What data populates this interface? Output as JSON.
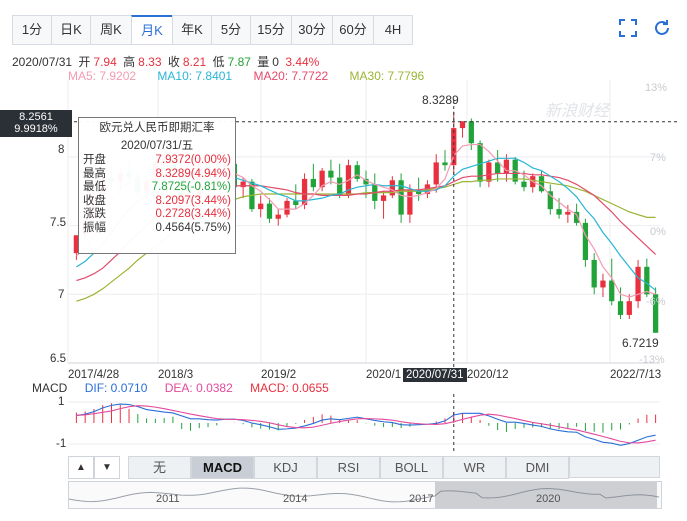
{
  "tabs": [
    {
      "label": "1分",
      "active": false
    },
    {
      "label": "日K",
      "active": false
    },
    {
      "label": "周K",
      "active": false
    },
    {
      "label": "月K",
      "active": true
    },
    {
      "label": "年K",
      "active": false
    },
    {
      "label": "5分",
      "active": false
    },
    {
      "label": "15分",
      "active": false
    },
    {
      "label": "30分",
      "active": false
    },
    {
      "label": "60分",
      "active": false
    },
    {
      "label": "4H",
      "active": false
    }
  ],
  "tools": {
    "fullscreen_icon": "fullscreen-icon",
    "refresh_icon": "refresh-icon"
  },
  "info": {
    "date": "2020/07/31",
    "open_label": "开",
    "open": "7.94",
    "high_label": "高",
    "high": "8.33",
    "close_label": "收",
    "close": "8.21",
    "low_label": "低",
    "low": "7.87",
    "vol_label": "量",
    "vol": "0",
    "change": "3.44%"
  },
  "ma": {
    "ma5": "MA5: 7.9202",
    "ma10": "MA10: 7.8401",
    "ma20": "MA20: 7.7722",
    "ma30": "MA30: 7.7796"
  },
  "colors": {
    "up": "#e8303e",
    "down": "#21a33a",
    "ma5": "#f39bb2",
    "ma10": "#29b5d6",
    "ma20": "#e34a6b",
    "ma30": "#9ab534",
    "accent": "#2a6fd6"
  },
  "crosshair": {
    "price": "8.2561",
    "pct": "9.9918%",
    "date": "2020/07/31",
    "high_label": "8.3289",
    "last_label": "6.7219"
  },
  "pct_labels": [
    "13%",
    "7%",
    "0%",
    "-6%",
    "-13%"
  ],
  "watermark": "新浪财经",
  "tooltip": {
    "title": "欧元兑人民币即期汇率",
    "date": "2020/07/31/五",
    "rows": [
      {
        "label": "开盘",
        "value": "7.9372(0.00%)"
      },
      {
        "label": "最高",
        "value": "8.3289(4.94%)"
      },
      {
        "label": "最低",
        "value": "7.8725(-0.81%)"
      },
      {
        "label": "收盘",
        "value": "8.2097(3.44%)"
      },
      {
        "label": "涨跌",
        "value": "0.2728(3.44%)"
      },
      {
        "label": "振幅",
        "value": "0.4564(5.75%)"
      }
    ]
  },
  "chart_data": {
    "type": "candlestick",
    "title": "欧元兑人民币即期汇率 月K",
    "ylim": [
      6.5,
      8.55
    ],
    "y_ticks": [
      "8",
      "7.5",
      "7",
      "6.5"
    ],
    "x_ticks": [
      "2017/4/28",
      "2018/3",
      "2019/2",
      "2020/1",
      "2020/12",
      "2022/7/13"
    ],
    "candles": [
      {
        "o": 7.3,
        "h": 7.42,
        "l": 7.25,
        "c": 7.43
      },
      {
        "o": 7.43,
        "h": 7.56,
        "l": 7.4,
        "c": 7.55
      },
      {
        "o": 7.55,
        "h": 7.75,
        "l": 7.53,
        "c": 7.72
      },
      {
        "o": 7.72,
        "h": 7.9,
        "l": 7.7,
        "c": 7.85
      },
      {
        "o": 7.85,
        "h": 7.93,
        "l": 7.78,
        "c": 7.82
      },
      {
        "o": 7.82,
        "h": 7.92,
        "l": 7.76,
        "c": 7.88
      },
      {
        "o": 7.88,
        "h": 7.99,
        "l": 7.8,
        "c": 7.85
      },
      {
        "o": 7.85,
        "h": 7.9,
        "l": 7.72,
        "c": 7.75
      },
      {
        "o": 7.75,
        "h": 7.85,
        "l": 7.7,
        "c": 7.83
      },
      {
        "o": 7.83,
        "h": 7.98,
        "l": 7.8,
        "c": 7.95
      },
      {
        "o": 7.95,
        "h": 8.02,
        "l": 7.9,
        "c": 7.98
      },
      {
        "o": 7.98,
        "h": 8.04,
        "l": 7.85,
        "c": 7.9
      },
      {
        "o": 7.9,
        "h": 7.95,
        "l": 7.65,
        "c": 7.72
      },
      {
        "o": 7.72,
        "h": 7.78,
        "l": 7.62,
        "c": 7.7
      },
      {
        "o": 7.7,
        "h": 8.05,
        "l": 7.68,
        "c": 7.99
      },
      {
        "o": 7.99,
        "h": 8.02,
        "l": 7.78,
        "c": 7.8
      },
      {
        "o": 7.8,
        "h": 7.95,
        "l": 7.78,
        "c": 7.9
      },
      {
        "o": 7.9,
        "h": 8.02,
        "l": 7.85,
        "c": 7.95
      },
      {
        "o": 7.95,
        "h": 7.97,
        "l": 7.72,
        "c": 7.78
      },
      {
        "o": 7.78,
        "h": 7.85,
        "l": 7.7,
        "c": 7.82
      },
      {
        "o": 7.82,
        "h": 7.84,
        "l": 7.6,
        "c": 7.62
      },
      {
        "o": 7.62,
        "h": 7.72,
        "l": 7.56,
        "c": 7.66
      },
      {
        "o": 7.66,
        "h": 7.7,
        "l": 7.52,
        "c": 7.55
      },
      {
        "o": 7.55,
        "h": 7.62,
        "l": 7.5,
        "c": 7.58
      },
      {
        "o": 7.58,
        "h": 7.7,
        "l": 7.56,
        "c": 7.68
      },
      {
        "o": 7.68,
        "h": 7.8,
        "l": 7.62,
        "c": 7.65
      },
      {
        "o": 7.65,
        "h": 7.88,
        "l": 7.62,
        "c": 7.84
      },
      {
        "o": 7.84,
        "h": 7.95,
        "l": 7.75,
        "c": 7.78
      },
      {
        "o": 7.78,
        "h": 7.92,
        "l": 7.75,
        "c": 7.9
      },
      {
        "o": 7.9,
        "h": 7.98,
        "l": 7.8,
        "c": 7.85
      },
      {
        "o": 7.85,
        "h": 7.95,
        "l": 7.7,
        "c": 7.72
      },
      {
        "o": 7.72,
        "h": 7.98,
        "l": 7.7,
        "c": 7.94
      },
      {
        "o": 7.94,
        "h": 7.97,
        "l": 7.82,
        "c": 7.84
      },
      {
        "o": 7.84,
        "h": 7.9,
        "l": 7.7,
        "c": 7.8
      },
      {
        "o": 7.8,
        "h": 7.88,
        "l": 7.62,
        "c": 7.68
      },
      {
        "o": 7.68,
        "h": 7.75,
        "l": 7.55,
        "c": 7.72
      },
      {
        "o": 7.72,
        "h": 7.86,
        "l": 7.7,
        "c": 7.83
      },
      {
        "o": 7.83,
        "h": 7.88,
        "l": 7.52,
        "c": 7.58
      },
      {
        "o": 7.58,
        "h": 7.8,
        "l": 7.52,
        "c": 7.76
      },
      {
        "o": 7.76,
        "h": 7.85,
        "l": 7.68,
        "c": 7.73
      },
      {
        "o": 7.73,
        "h": 7.83,
        "l": 7.7,
        "c": 7.8
      },
      {
        "o": 7.8,
        "h": 8.02,
        "l": 7.74,
        "c": 7.96
      },
      {
        "o": 7.96,
        "h": 8.05,
        "l": 7.9,
        "c": 7.94
      },
      {
        "o": 7.94,
        "h": 8.33,
        "l": 7.87,
        "c": 8.21
      },
      {
        "o": 8.21,
        "h": 8.25,
        "l": 8.14,
        "c": 8.26
      },
      {
        "o": 8.26,
        "h": 8.28,
        "l": 8.05,
        "c": 8.1
      },
      {
        "o": 8.1,
        "h": 8.12,
        "l": 7.78,
        "c": 7.82
      },
      {
        "o": 7.82,
        "h": 7.98,
        "l": 7.78,
        "c": 7.96
      },
      {
        "o": 7.96,
        "h": 8.05,
        "l": 7.82,
        "c": 7.88
      },
      {
        "o": 7.88,
        "h": 8.02,
        "l": 7.82,
        "c": 7.98
      },
      {
        "o": 7.98,
        "h": 8.0,
        "l": 7.8,
        "c": 7.82
      },
      {
        "o": 7.82,
        "h": 7.9,
        "l": 7.75,
        "c": 7.78
      },
      {
        "o": 7.78,
        "h": 7.88,
        "l": 7.74,
        "c": 7.86
      },
      {
        "o": 7.86,
        "h": 7.9,
        "l": 7.74,
        "c": 7.75
      },
      {
        "o": 7.75,
        "h": 7.8,
        "l": 7.58,
        "c": 7.62
      },
      {
        "o": 7.62,
        "h": 7.7,
        "l": 7.55,
        "c": 7.58
      },
      {
        "o": 7.58,
        "h": 7.65,
        "l": 7.52,
        "c": 7.6
      },
      {
        "o": 7.6,
        "h": 7.66,
        "l": 7.5,
        "c": 7.52
      },
      {
        "o": 7.52,
        "h": 7.55,
        "l": 7.2,
        "c": 7.25
      },
      {
        "o": 7.25,
        "h": 7.3,
        "l": 7.0,
        "c": 7.05
      },
      {
        "o": 7.05,
        "h": 7.15,
        "l": 6.98,
        "c": 7.1
      },
      {
        "o": 7.1,
        "h": 7.26,
        "l": 6.92,
        "c": 6.95
      },
      {
        "o": 6.95,
        "h": 7.05,
        "l": 6.82,
        "c": 6.85
      },
      {
        "o": 6.85,
        "h": 7.0,
        "l": 6.82,
        "c": 6.95
      },
      {
        "o": 6.95,
        "h": 7.25,
        "l": 6.9,
        "c": 7.2
      },
      {
        "o": 7.2,
        "h": 7.26,
        "l": 6.98,
        "c": 7.0
      },
      {
        "o": 7.0,
        "h": 7.05,
        "l": 6.72,
        "c": 6.72
      }
    ],
    "ma5": [
      7.28,
      7.33,
      7.42,
      7.55,
      7.67,
      7.76,
      7.82,
      7.83,
      7.82,
      7.85,
      7.87,
      7.9,
      7.86,
      7.81,
      7.83,
      7.83,
      7.84,
      7.87,
      7.88,
      7.85,
      7.79,
      7.75,
      7.69,
      7.62,
      7.62,
      7.62,
      7.66,
      7.72,
      7.79,
      7.82,
      7.8,
      7.83,
      7.87,
      7.83,
      7.8,
      7.78,
      7.76,
      7.72,
      7.71,
      7.72,
      7.74,
      7.77,
      7.84,
      8.01,
      8.08,
      8.09,
      8.09,
      8.04,
      7.97,
      7.9,
      7.9,
      7.87,
      7.82,
      7.79,
      7.72,
      7.67,
      7.62,
      7.58,
      7.43,
      7.33,
      7.2,
      7.12,
      7.0,
      6.98,
      7.0,
      7.02,
      7.0
    ],
    "ma10": [
      7.2,
      7.24,
      7.3,
      7.37,
      7.45,
      7.54,
      7.62,
      7.68,
      7.72,
      7.77,
      7.81,
      7.83,
      7.84,
      7.83,
      7.83,
      7.85,
      7.85,
      7.86,
      7.85,
      7.83,
      7.81,
      7.79,
      7.76,
      7.73,
      7.71,
      7.68,
      7.68,
      7.69,
      7.7,
      7.72,
      7.73,
      7.76,
      7.78,
      7.79,
      7.8,
      7.79,
      7.79,
      7.79,
      7.77,
      7.75,
      7.75,
      7.76,
      7.79,
      7.86,
      7.91,
      7.93,
      7.95,
      7.97,
      7.99,
      7.99,
      7.99,
      7.96,
      7.92,
      7.9,
      7.86,
      7.82,
      7.77,
      7.71,
      7.62,
      7.55,
      7.45,
      7.37,
      7.28,
      7.2,
      7.12,
      7.08,
      7.03
    ],
    "ma20": [
      7.1,
      7.12,
      7.15,
      7.19,
      7.25,
      7.31,
      7.38,
      7.44,
      7.5,
      7.56,
      7.61,
      7.66,
      7.69,
      7.71,
      7.73,
      7.75,
      7.77,
      7.78,
      7.79,
      7.79,
      7.79,
      7.79,
      7.78,
      7.77,
      7.76,
      7.74,
      7.73,
      7.73,
      7.72,
      7.72,
      7.72,
      7.72,
      7.73,
      7.73,
      7.74,
      7.75,
      7.75,
      7.76,
      7.76,
      7.76,
      7.77,
      7.78,
      7.79,
      7.82,
      7.85,
      7.86,
      7.86,
      7.87,
      7.88,
      7.88,
      7.88,
      7.88,
      7.87,
      7.87,
      7.86,
      7.85,
      7.83,
      7.8,
      7.76,
      7.72,
      7.66,
      7.6,
      7.53,
      7.47,
      7.41,
      7.35,
      7.29
    ],
    "ma30": [
      6.95,
      6.97,
      7.0,
      7.04,
      7.09,
      7.14,
      7.19,
      7.25,
      7.3,
      7.35,
      7.4,
      7.45,
      7.5,
      7.54,
      7.58,
      7.61,
      7.64,
      7.67,
      7.69,
      7.71,
      7.72,
      7.73,
      7.73,
      7.73,
      7.73,
      7.73,
      7.73,
      7.73,
      7.73,
      7.73,
      7.73,
      7.73,
      7.73,
      7.74,
      7.74,
      7.74,
      7.74,
      7.75,
      7.75,
      7.75,
      7.76,
      7.77,
      7.78,
      7.8,
      7.82,
      7.82,
      7.83,
      7.83,
      7.84,
      7.84,
      7.84,
      7.84,
      7.83,
      7.82,
      7.81,
      7.8,
      7.79,
      7.77,
      7.75,
      7.72,
      7.69,
      7.66,
      7.63,
      7.6,
      7.58,
      7.56,
      7.56
    ]
  },
  "macd": {
    "label": "MACD",
    "dif": "DIF: 0.0710",
    "dea": "DEA: 0.0382",
    "macd": "MACD: 0.0655",
    "y_ticks": [
      "1",
      "-1"
    ]
  },
  "indicator_tabs": [
    {
      "label": "无",
      "active": false
    },
    {
      "label": "MACD",
      "active": true
    },
    {
      "label": "KDJ",
      "active": false
    },
    {
      "label": "RSI",
      "active": false
    },
    {
      "label": "BOLL",
      "active": false
    },
    {
      "label": "WR",
      "active": false
    },
    {
      "label": "DMI",
      "active": false
    }
  ],
  "navigator": {
    "labels": [
      "2011",
      "2014",
      "2017",
      "2020"
    ]
  }
}
